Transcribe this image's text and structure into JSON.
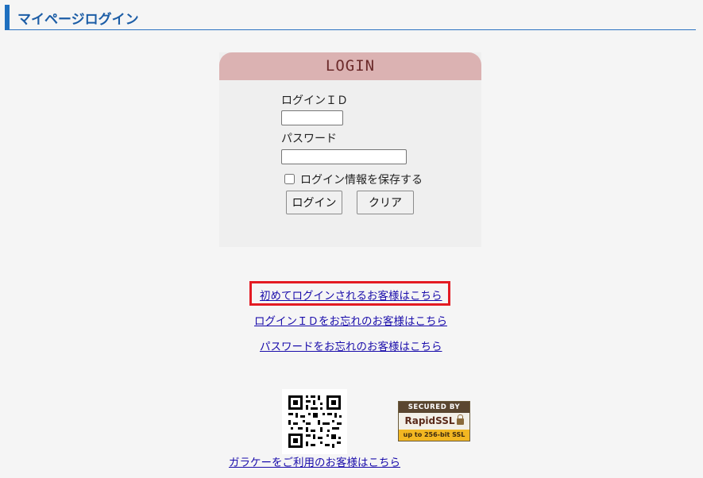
{
  "header": {
    "title": "マイページログイン"
  },
  "login": {
    "heading": "LOGIN",
    "id_label": "ログインＩＤ",
    "id_value": "",
    "password_label": "パスワード",
    "password_value": "",
    "remember_label": "ログイン情報を保存する",
    "remember_checked": false,
    "login_button": "ログイン",
    "clear_button": "クリア"
  },
  "links": {
    "first_login": "初めてログインされるお客様はこちら",
    "forgot_id": "ログインＩＤをお忘れのお客様はこちら",
    "forgot_password": "パスワードをお忘れのお客様はこちら",
    "feature_phone": "ガラケーをご利用のお客様はこちら"
  },
  "ssl_badge": {
    "top": "SECURED BY",
    "brand": "RapidSSL",
    "bottom": "up to 256-bit SSL"
  },
  "colors": {
    "accent": "#1e6fbf",
    "login_header": "#dbb2b2",
    "highlight": "#e31b23",
    "link": "#1a0dab"
  },
  "icons": [
    "qr-code-icon",
    "lock-icon"
  ]
}
